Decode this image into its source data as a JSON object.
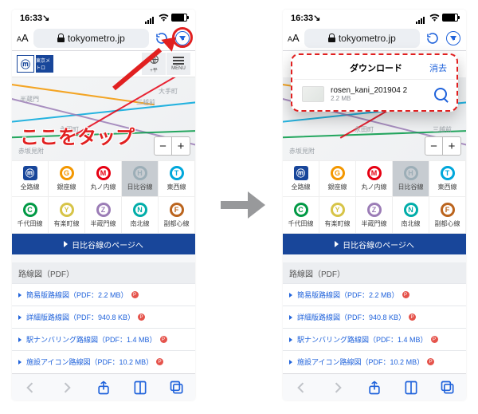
{
  "status": {
    "time": "16:33",
    "arr": "↘"
  },
  "url": {
    "domain": "tokyometro.jp"
  },
  "menu_label": "MENU",
  "map": {
    "zoom_minus": "−",
    "zoom_plus": "+",
    "stations": [
      "大手町",
      "三越前",
      "半蔵門",
      "永田町",
      "赤坂見附"
    ]
  },
  "lines": {
    "row1": [
      {
        "letter": "M",
        "label": "全路線",
        "color": "#18469a",
        "square": true
      },
      {
        "letter": "G",
        "label": "銀座線",
        "color": "#f39700"
      },
      {
        "letter": "M",
        "label": "丸ノ内線",
        "color": "#e60012"
      },
      {
        "letter": "H",
        "label": "日比谷線",
        "color": "#9caeb7",
        "selected": true
      },
      {
        "letter": "T",
        "label": "東西線",
        "color": "#00a7db"
      }
    ],
    "row2": [
      {
        "letter": "C",
        "label": "千代田線",
        "color": "#009944"
      },
      {
        "letter": "Y",
        "label": "有楽町線",
        "color": "#d7c447"
      },
      {
        "letter": "Z",
        "label": "半蔵門線",
        "color": "#9b7cb6"
      },
      {
        "letter": "N",
        "label": "南北線",
        "color": "#00ada9"
      },
      {
        "letter": "F",
        "label": "副都心線",
        "color": "#bb641d"
      }
    ]
  },
  "go_btn": "日比谷線のページへ",
  "pdf": {
    "header": "路線図（PDF）",
    "items": [
      {
        "label": "簡易版路線図（PDF：2.2 MB）"
      },
      {
        "label": "詳細版路線図（PDF：940.8 KB）"
      },
      {
        "label": "駅ナンバリング路線図（PDF：1.4 MB）"
      },
      {
        "label": "施設アイコン路線図（PDF：10.2 MB）"
      }
    ]
  },
  "annot": {
    "tap": "ここをタップ"
  },
  "downloads": {
    "title": "ダウンロード",
    "clear": "消去",
    "file": {
      "name": "rosen_kani_201904 2",
      "size": "2.2 MB"
    }
  },
  "world_label": "+平"
}
